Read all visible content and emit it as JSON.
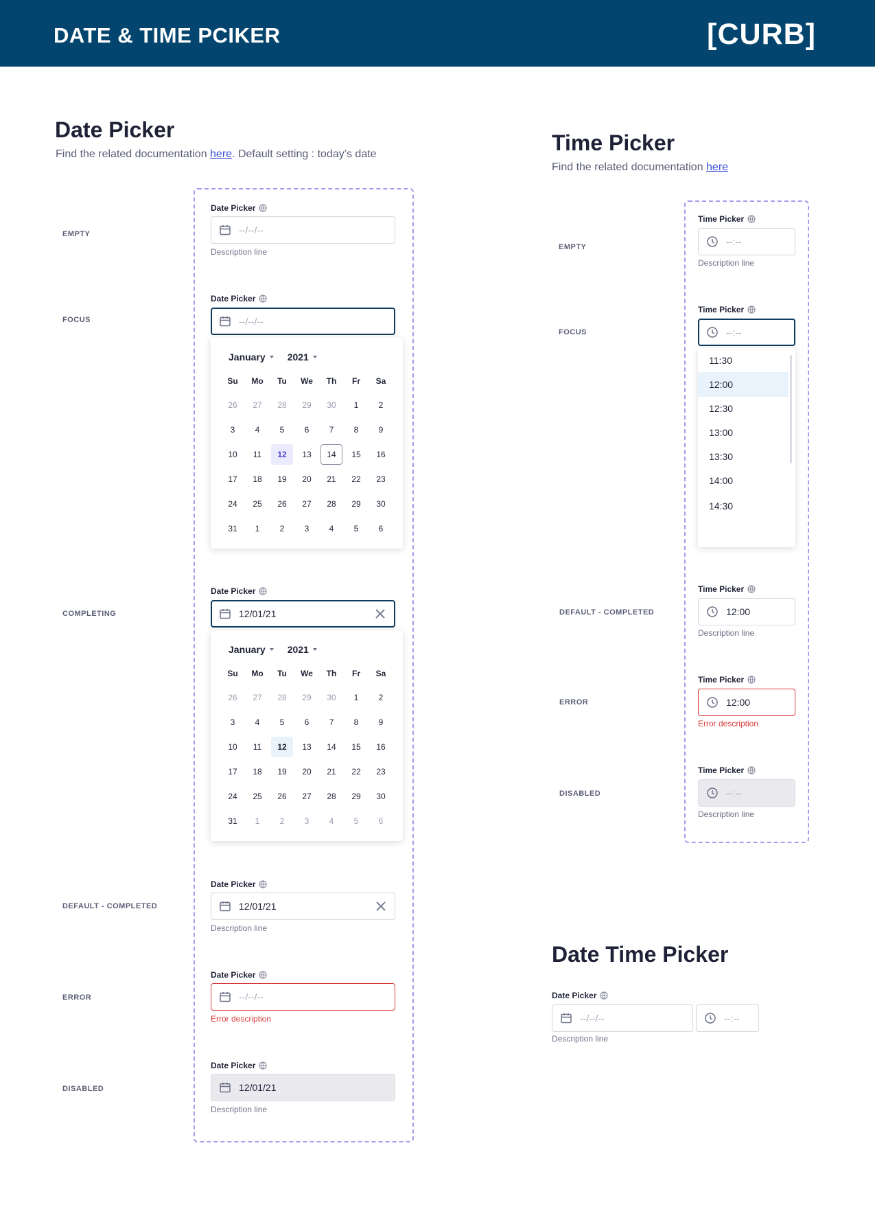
{
  "header": {
    "title": "DATE & TIME PCIKER",
    "logo": "[CURB]"
  },
  "date_section": {
    "title": "Date Picker",
    "sub_pre": "Find the related documentation ",
    "sub_link": "here",
    "sub_post": ". Default setting : today’s date"
  },
  "time_section": {
    "title": "Time Picker",
    "sub_pre": "Find the related documentation ",
    "sub_link": "here"
  },
  "datetime_section": {
    "title": "Date Time Picker"
  },
  "states": {
    "empty": "EMPTY",
    "focus": "FOCUS",
    "completing": "COMPLETING",
    "default_completed": "DEFAULT - COMPLETED",
    "error": "ERROR",
    "disabled": "DISABLED"
  },
  "date_label": "Date Picker",
  "time_label": "Time Picker",
  "date_placeholder": "--/--/--",
  "time_placeholder": "--:--",
  "date_value": "12/01/21",
  "time_value": "12:00",
  "description": "Description line",
  "error_description": "Error description",
  "calendar": {
    "month": "January",
    "year": "2021",
    "weekdays": [
      "Su",
      "Mo",
      "Tu",
      "We",
      "Th",
      "Fr",
      "Sa"
    ],
    "days": [
      "26",
      "27",
      "28",
      "29",
      "30",
      "1",
      "2",
      "3",
      "4",
      "5",
      "6",
      "7",
      "8",
      "9",
      "10",
      "11",
      "12",
      "13",
      "14",
      "15",
      "16",
      "17",
      "18",
      "19",
      "20",
      "21",
      "22",
      "23",
      "24",
      "25",
      "26",
      "27",
      "28",
      "29",
      "30",
      "31",
      "1",
      "2",
      "3",
      "4",
      "5",
      "6"
    ],
    "outside_indices": [
      0,
      1,
      2,
      3,
      4,
      36,
      37,
      38,
      39,
      40,
      41
    ],
    "selected_day": "12",
    "today_day": "14"
  },
  "time_options": [
    "11:30",
    "12:00",
    "12:30",
    "13:00",
    "13:30",
    "14:00",
    "14:30"
  ],
  "time_highlighted": "12:00",
  "colors": {
    "header_bg": "#03456e",
    "focus_border": "#0d3c5e",
    "error": "#d93a3a",
    "dashed_frame": "#a39cf0",
    "link": "#3a4fd8"
  },
  "icons": {
    "date": "calendar-icon",
    "time": "clock-icon",
    "label_info": "globe-icon",
    "clear": "close-icon"
  }
}
